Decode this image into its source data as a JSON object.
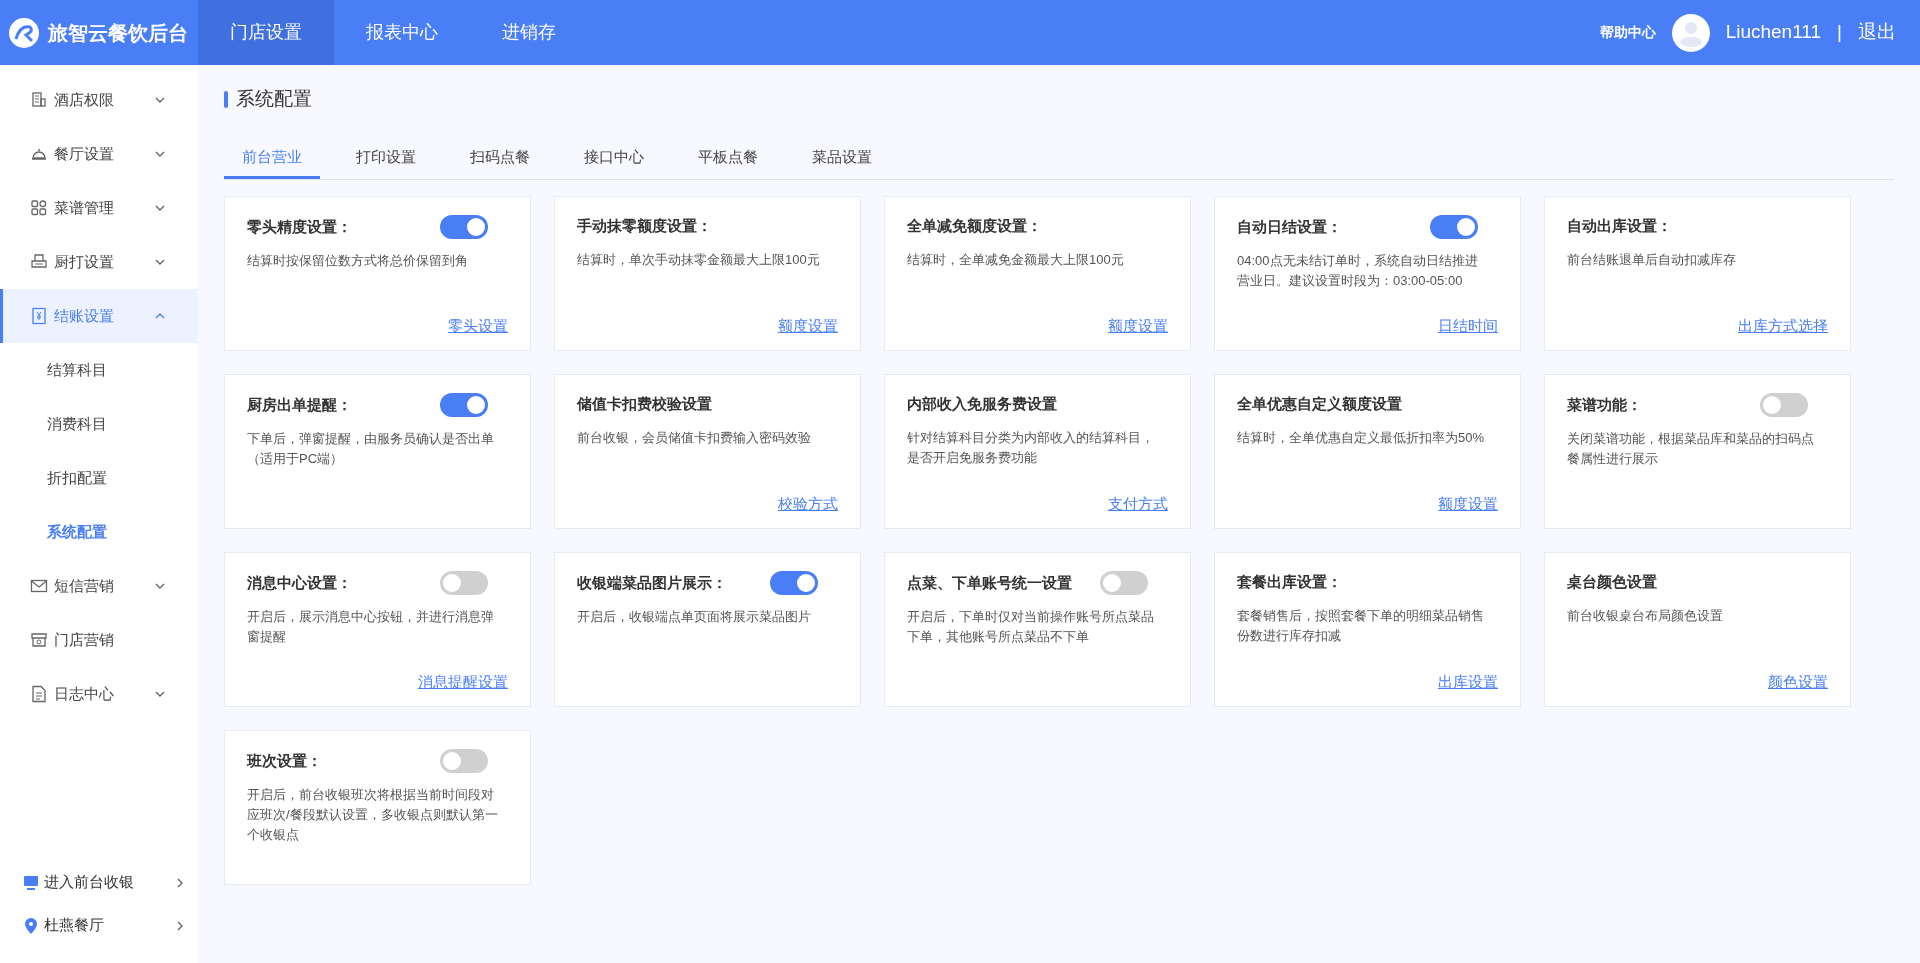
{
  "header": {
    "brand": "旅智云餐饮后台",
    "nav": [
      {
        "label": "门店设置",
        "selected": true
      },
      {
        "label": "报表中心",
        "selected": false
      },
      {
        "label": "进销存",
        "selected": false
      }
    ],
    "help": "帮助中心",
    "user": "Liuchen111",
    "separator": "|",
    "logout": "退出"
  },
  "sidebar": {
    "items": [
      {
        "label": "酒店权限",
        "expanded": false,
        "selected": false
      },
      {
        "label": "餐厅设置",
        "expanded": false,
        "selected": false
      },
      {
        "label": "菜谱管理",
        "expanded": false,
        "selected": false
      },
      {
        "label": "厨打设置",
        "expanded": false,
        "selected": false
      },
      {
        "label": "结账设置",
        "expanded": true,
        "selected": true,
        "children": [
          {
            "label": "结算科目",
            "selected": false
          },
          {
            "label": "消费科目",
            "selected": false
          },
          {
            "label": "折扣配置",
            "selected": false
          },
          {
            "label": "系统配置",
            "selected": true
          }
        ]
      },
      {
        "label": "短信营销",
        "expanded": false,
        "selected": false
      },
      {
        "label": "门店营销",
        "selected": false
      },
      {
        "label": "日志中心",
        "expanded": false,
        "selected": false
      }
    ],
    "footer": [
      {
        "label": "进入前台收银"
      },
      {
        "label": "杜燕餐厅"
      }
    ]
  },
  "page_title": "系统配置",
  "tabs": [
    {
      "label": "前台营业",
      "selected": true
    },
    {
      "label": "打印设置",
      "selected": false
    },
    {
      "label": "扫码点餐",
      "selected": false
    },
    {
      "label": "接口中心",
      "selected": false
    },
    {
      "label": "平板点餐",
      "selected": false
    },
    {
      "label": "菜品设置",
      "selected": false
    }
  ],
  "cards": [
    {
      "title": "零头精度设置：",
      "toggle": {
        "on": true
      },
      "description": "结算时按保留位数方式将总价保留到角",
      "link": "零头设置"
    },
    {
      "title": "手动抹零额度设置：",
      "description": "结算时，单次手动抹零金额最大上限100元",
      "link": "额度设置"
    },
    {
      "title": "全单减免额度设置：",
      "description": "结算时，全单减免金额最大上限100元",
      "link": "额度设置"
    },
    {
      "title": "自动日结设置：",
      "toggle": {
        "on": true
      },
      "description": "04:00点无未结订单时，系统自动日结推进营业日。建议设置时段为：03:00-05:00",
      "link": "日结时间"
    },
    {
      "title": "自动出库设置：",
      "description": "前台结账退单后自动扣减库存",
      "link": "出库方式选择"
    },
    {
      "title": "厨房出单提醒：",
      "toggle": {
        "on": true
      },
      "description": "下单后，弹窗提醒，由服务员确认是否出单（适用于PC端）"
    },
    {
      "title": "储值卡扣费校验设置",
      "description": "前台收银，会员储值卡扣费输入密码效验",
      "link": "校验方式"
    },
    {
      "title": "内部收入免服务费设置",
      "description": "针对结算科目分类为内部收入的结算科目，是否开启免服务费功能",
      "link": "支付方式"
    },
    {
      "title": "全单优惠自定义额度设置",
      "description": "结算时，全单优惠自定义最低折扣率为50%",
      "link": "额度设置"
    },
    {
      "title": "菜谱功能：",
      "toggle": {
        "on": false
      },
      "description": "关闭菜谱功能，根据菜品库和菜品的扫码点餐属性进行展示"
    },
    {
      "title": "消息中心设置：",
      "toggle": {
        "on": false
      },
      "description": "开启后，展示消息中心按钮，并进行消息弹窗提醒",
      "link": "消息提醒设置"
    },
    {
      "title": "收银端菜品图片展示：",
      "toggle": {
        "on": true
      },
      "description": "开启后，收银端点单页面将展示菜品图片"
    },
    {
      "title": "点菜、下单账号统一设置",
      "toggle": {
        "on": false
      },
      "description": "开启后，下单时仅对当前操作账号所点菜品下单，其他账号所点菜品不下单"
    },
    {
      "title": "套餐出库设置：",
      "description": "套餐销售后，按照套餐下单的明细菜品销售份数进行库存扣减",
      "link": "出库设置"
    },
    {
      "title": "桌台颜色设置",
      "description": "前台收银桌台布局颜色设置",
      "link": "颜色设置"
    },
    {
      "title": "班次设置：",
      "toggle": {
        "on": false
      },
      "description": "开启后，前台收银班次将根据当前时间段对应班次/餐段默认设置，多收银点则默认第一个收银点"
    }
  ]
}
